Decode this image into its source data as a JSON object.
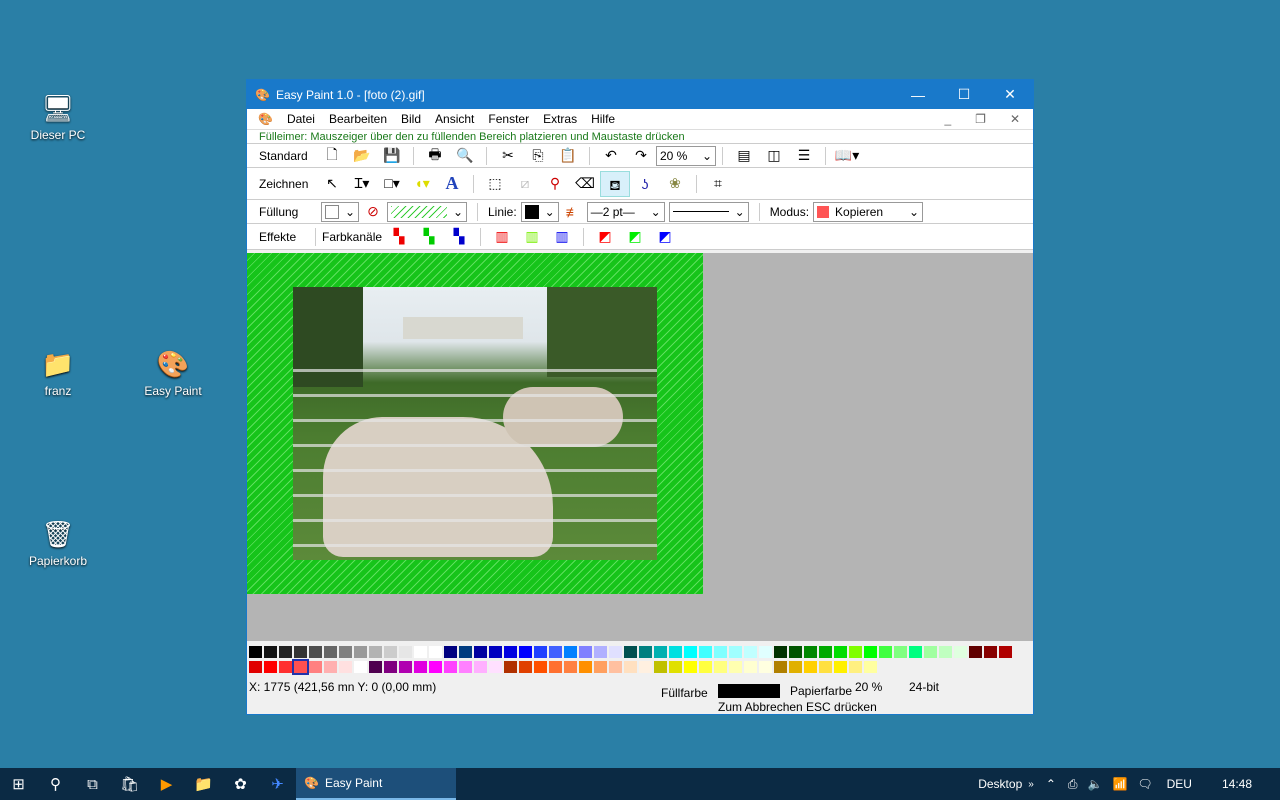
{
  "desktop": {
    "icons": [
      {
        "label": "Dieser PC",
        "icon": "computer-icon"
      },
      {
        "label": "franz",
        "icon": "user-folder-icon"
      },
      {
        "label": "Easy Paint",
        "icon": "easy-paint-icon"
      },
      {
        "label": "Papierkorb",
        "icon": "recycle-bin-icon"
      }
    ]
  },
  "window": {
    "title": "Easy Paint 1.0 - [foto (2).gif]"
  },
  "menu": [
    "Datei",
    "Bearbeiten",
    "Bild",
    "Ansicht",
    "Fenster",
    "Extras",
    "Hilfe"
  ],
  "hint": "Fülleimer: Mauszeiger über den zu füllenden Bereich platzieren und Maustaste drücken",
  "toolbars": {
    "standard": "Standard",
    "zoom": "20 %",
    "zeichnen": "Zeichnen",
    "fuellung": "Füllung",
    "linie": "Linie:",
    "line_width": "2 pt",
    "modus": "Modus:",
    "modus_value": "Kopieren",
    "effekte": "Effekte",
    "farbkanaele": "Farbkanäle"
  },
  "palette": {
    "row1": [
      "#000000",
      "#111111",
      "#222222",
      "#333333",
      "#4d4d4d",
      "#666666",
      "#808080",
      "#999999",
      "#b3b3b3",
      "#cccccc",
      "#e6e6e6",
      "#ffffff",
      "#ffffff",
      "#000080",
      "#003c80",
      "#0000a0",
      "#0000c0",
      "#0000e0",
      "#0000ff",
      "#2040ff",
      "#4060ff",
      "#0080ff",
      "#8080ff",
      "#b0b0ff",
      "#e0e0ff",
      "#005050",
      "#008080",
      "#00b0b0",
      "#00e0e0",
      "#00ffff",
      "#40ffff",
      "#80ffff",
      "#a0ffff",
      "#c0ffff",
      "#e0ffff",
      "#003300",
      "#005500",
      "#008800",
      "#00aa00",
      "#00dd00",
      "#80ff00",
      "#00ff00",
      "#40ff40",
      "#80ff80",
      "#00ff80",
      "#a0ffa0",
      "#c0ffc0",
      "#e0ffe0",
      "#600000",
      "#880000",
      "#b00000"
    ],
    "row2": [
      "#e00000",
      "#ff0000",
      "#ff3030",
      "#ff5050",
      "#ff8080",
      "#ffb0b0",
      "#ffe0e0",
      "#ffffff",
      "#500050",
      "#800080",
      "#b000b0",
      "#e000e0",
      "#ff00ff",
      "#ff40ff",
      "#ff80ff",
      "#ffb0ff",
      "#ffe0ff",
      "#b03000",
      "#e04000",
      "#ff5000",
      "#ff7030",
      "#ff8040",
      "#ff9000",
      "#ffa060",
      "#ffc0a0",
      "#ffe0c0",
      "#fff0e0",
      "#c0c000",
      "#e0e000",
      "#ffff00",
      "#ffff40",
      "#ffff80",
      "#ffffb0",
      "#ffffd0",
      "#ffffe0",
      "#b08000",
      "#e0b000",
      "#ffd000",
      "#ffe040",
      "#fff000",
      "#fff080",
      "#ffffa0"
    ],
    "selected": "#ff5050"
  },
  "status": {
    "coords": "X: 1775 (421,56 mn Y: 0 (0,00 mm)",
    "fuellfarbe": "Füllfarbe",
    "papierfarbe": "Papierfarbe",
    "zoom": "20 %",
    "depth": "24-bit",
    "esc": "Zum Abbrechen ESC drücken"
  },
  "taskbar": {
    "app": "Easy Paint",
    "desktop": "Desktop",
    "lang": "DEU",
    "time": "14:48"
  }
}
